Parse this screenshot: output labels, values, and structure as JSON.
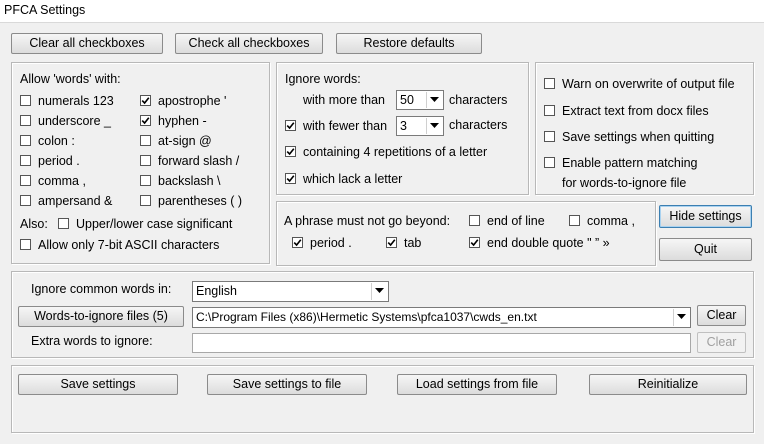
{
  "window": {
    "title": "PFCA Settings"
  },
  "top_buttons": {
    "clear_all": "Clear all checkboxes",
    "check_all": "Check all checkboxes",
    "restore": "Restore defaults"
  },
  "allow_words": {
    "heading": "Allow 'words' with:",
    "items": [
      {
        "label": "numerals 123",
        "checked": false
      },
      {
        "label": "underscore _",
        "checked": false
      },
      {
        "label": "colon :",
        "checked": false
      },
      {
        "label": "period .",
        "checked": false
      },
      {
        "label": "comma ,",
        "checked": false
      },
      {
        "label": "ampersand &",
        "checked": false
      },
      {
        "label": "apostrophe '",
        "checked": true
      },
      {
        "label": "hyphen -",
        "checked": true
      },
      {
        "label": "at-sign @",
        "checked": false
      },
      {
        "label": "forward slash /",
        "checked": false
      },
      {
        "label": "backslash \\",
        "checked": false
      },
      {
        "label": "parentheses ( )",
        "checked": false
      }
    ],
    "also_label": "Also:",
    "case_label": "Upper/lower case significant",
    "case_checked": false,
    "ascii_label": "Allow only 7-bit ASCII characters",
    "ascii_checked": false
  },
  "ignore_words": {
    "heading": "Ignore words:",
    "more_than_label": "with more than",
    "more_than_value": "50",
    "more_than_unit": "characters",
    "fewer_than_label": "with fewer than",
    "fewer_than_checked": true,
    "fewer_than_value": "3",
    "fewer_than_unit": "characters",
    "repetitions_label": "containing 4 repetitions of a letter",
    "repetitions_checked": true,
    "lack_letter_label": "which lack a letter",
    "lack_letter_checked": true
  },
  "options": {
    "warn_label": "Warn on overwrite of output file",
    "warn_checked": false,
    "docx_label": "Extract text from docx files",
    "docx_checked": false,
    "save_quit_label": "Save settings when quitting",
    "save_quit_checked": false,
    "pattern_label_1": "Enable pattern matching",
    "pattern_label_2": "for words-to-ignore file",
    "pattern_checked": false
  },
  "phrase": {
    "heading": "A phrase must not go beyond:",
    "end_line_label": "end of line",
    "end_line_checked": false,
    "comma_label": "comma ,",
    "comma_checked": false,
    "period_label": "period .",
    "period_checked": true,
    "tab_label": "tab",
    "tab_checked": true,
    "quote_label": "end double quote \" ” »",
    "quote_checked": true
  },
  "side_buttons": {
    "hide": "Hide settings",
    "quit": "Quit"
  },
  "common_words": {
    "label": "Ignore common words in:",
    "language": "English",
    "files_button": "Words-to-ignore files (5)",
    "file_path": "C:\\Program Files (x86)\\Hermetic Systems\\pfca1037\\cwds_en.txt",
    "clear_label": "Clear",
    "extra_label": "Extra words to ignore:",
    "extra_value": "",
    "extra_clear_label": "Clear"
  },
  "bottom_buttons": {
    "save": "Save settings",
    "save_to_file": "Save settings to file",
    "load": "Load settings from file",
    "reinit": "Reinitialize"
  },
  "colors": {
    "background": "#f0f0f0",
    "group_border": "#b8b8b8",
    "default_button_border": "#3c7fb1"
  }
}
